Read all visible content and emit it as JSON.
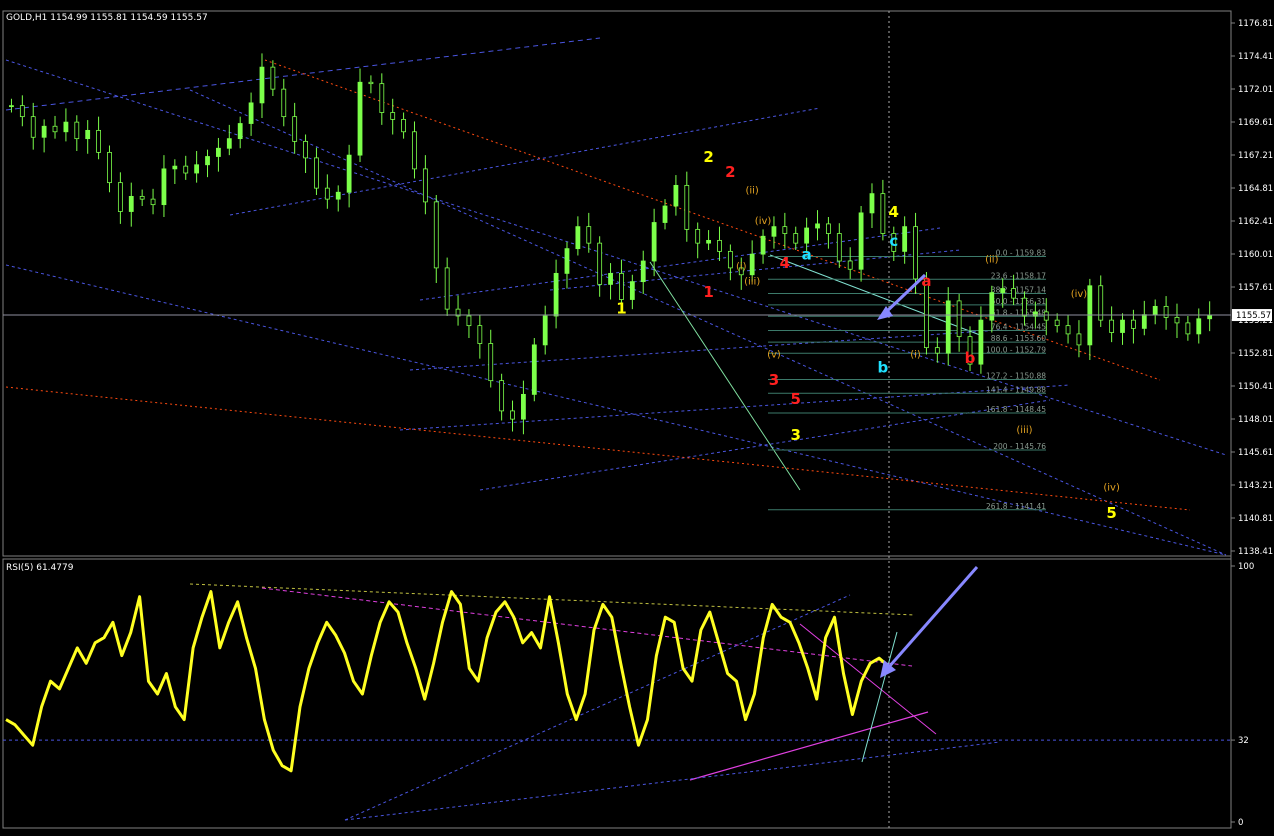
{
  "colors": {
    "background": "#000000",
    "frame": "#808080",
    "grid_blue": "#4a55e0",
    "candle_up": "#7cff4a",
    "orange_line": "#ff4a10",
    "fib": "#3c7a6a",
    "rsi_line": "#ffff22",
    "rsi_magenta": "#e040e0",
    "arrow": "#8888ff",
    "wave_yellow": "#ffff00",
    "wave_red": "#ff2020",
    "wave_cyan": "#20e0ff",
    "wave_orange": "#e0a020"
  },
  "chart_data": [
    {
      "type": "line",
      "title": "GOLD,H1  1154.99 1155.81 1154.59 1155.57",
      "symbol": "GOLD,H1",
      "ohlc": {
        "open": 1154.99,
        "high": 1155.81,
        "low": 1154.59,
        "close": 1155.57
      },
      "price_axis": {
        "min": 1138.41,
        "max": 1176.81,
        "ticks": [
          "1176.81",
          "1174.41",
          "1172.01",
          "1169.61",
          "1167.21",
          "1164.81",
          "1162.41",
          "1160.01",
          "1157.61",
          "1155.21",
          "1152.81",
          "1150.41",
          "1148.01",
          "1145.61",
          "1143.21",
          "1140.81",
          "1138.41"
        ]
      },
      "current_price": "1155.57",
      "series": [
        {
          "values": [
            1170.8,
            1170.0,
            1168.5,
            1169.3,
            1168.9,
            1169.6,
            1168.4,
            1169.0,
            1167.4,
            1165.2,
            1163.1,
            1164.2,
            1164.0,
            1163.6,
            1166.2,
            1166.4,
            1165.9,
            1166.5,
            1167.1,
            1167.7,
            1168.4,
            1169.5,
            1171.0,
            1173.6,
            1172.0,
            1170.0,
            1168.2,
            1167.0,
            1164.8,
            1164.0,
            1164.5,
            1167.2,
            1172.5,
            1172.4,
            1170.3,
            1169.8,
            1168.9,
            1166.2,
            1163.8,
            1159.0,
            1156.0,
            1155.5,
            1154.8,
            1153.5,
            1150.8,
            1148.6,
            1148.0,
            1149.8,
            1153.4,
            1155.5,
            1158.6,
            1160.4,
            1162.0,
            1160.8,
            1157.8,
            1158.6,
            1156.7,
            1158.0,
            1159.5,
            1162.3,
            1163.5,
            1165.0,
            1161.8,
            1160.8,
            1161.0,
            1160.2,
            1159.0,
            1158.5,
            1160.0,
            1161.3,
            1162.0,
            1161.5,
            1160.8,
            1161.9,
            1162.2,
            1161.5,
            1159.5,
            1158.9,
            1163.0,
            1164.4,
            1161.5,
            1160.2,
            1162.0,
            1158.2,
            1153.2,
            1152.8,
            1156.6,
            1154.0,
            1152.0,
            1155.2,
            1157.2,
            1157.5,
            1156.8,
            1155.5,
            1155.8,
            1155.2,
            1154.8,
            1154.2,
            1153.4,
            1157.7,
            1155.2,
            1154.3,
            1155.2,
            1154.6,
            1155.6,
            1156.2,
            1155.4,
            1155.0,
            1154.2,
            1155.3,
            1155.57
          ]
        }
      ],
      "fibonacci": [
        {
          "label": "0.0 - 1159.83",
          "price": 1159.83
        },
        {
          "label": "23.6 - 1158.17",
          "price": 1158.17
        },
        {
          "label": "38.2 - 1157.14",
          "price": 1157.14
        },
        {
          "label": "50.0 - 1156.31",
          "price": 1156.31
        },
        {
          "label": "61.8 - 1155.48",
          "price": 1155.48
        },
        {
          "label": "76.4 - 1154.45",
          "price": 1154.45
        },
        {
          "label": "88.6 - 1153.60",
          "price": 1153.6
        },
        {
          "label": "100.0 - 1152.79",
          "price": 1152.79
        },
        {
          "label": "127.2 - 1150.88",
          "price": 1150.88
        },
        {
          "label": "141.4 - 1149.88",
          "price": 1149.88
        },
        {
          "label": "161.8 - 1148.45",
          "price": 1148.45
        },
        {
          "label": "200 - 1145.76",
          "price": 1145.76
        },
        {
          "label": "261.8 - 1141.41",
          "price": 1141.41
        }
      ],
      "wave_labels": [
        {
          "text": "1",
          "color": "wave_yellow",
          "bar": 56,
          "price": 1155.7
        },
        {
          "text": "2",
          "color": "wave_yellow",
          "bar": 64,
          "price": 1166.7
        },
        {
          "text": "2",
          "color": "wave_red",
          "bar": 66,
          "price": 1165.6
        },
        {
          "text": "(ii)",
          "color": "wave_orange",
          "bar": 68,
          "price": 1164.4
        },
        {
          "text": "(iv)",
          "color": "wave_orange",
          "bar": 69,
          "price": 1162.2
        },
        {
          "text": "1",
          "color": "wave_red",
          "bar": 64,
          "price": 1156.9
        },
        {
          "text": "(i)",
          "color": "wave_orange",
          "bar": 67,
          "price": 1158.9
        },
        {
          "text": "(iii)",
          "color": "wave_orange",
          "bar": 68,
          "price": 1157.8
        },
        {
          "text": "4",
          "color": "wave_red",
          "bar": 71,
          "price": 1159.0
        },
        {
          "text": "a",
          "color": "wave_cyan",
          "bar": 73,
          "price": 1159.6
        },
        {
          "text": "(v)",
          "color": "wave_orange",
          "bar": 70,
          "price": 1152.5
        },
        {
          "text": "3",
          "color": "wave_red",
          "bar": 70,
          "price": 1150.5
        },
        {
          "text": "5",
          "color": "wave_red",
          "bar": 72,
          "price": 1149.1
        },
        {
          "text": "3",
          "color": "wave_yellow",
          "bar": 72,
          "price": 1146.5
        },
        {
          "text": "4",
          "color": "wave_yellow",
          "bar": 81,
          "price": 1162.7
        },
        {
          "text": "c",
          "color": "wave_cyan",
          "bar": 81,
          "price": 1160.6
        },
        {
          "text": "b",
          "color": "wave_cyan",
          "bar": 80,
          "price": 1151.4
        },
        {
          "text": "(i)",
          "color": "wave_orange",
          "bar": 83,
          "price": 1152.5
        },
        {
          "text": "a",
          "color": "wave_red",
          "bar": 84,
          "price": 1157.7
        },
        {
          "text": "b",
          "color": "wave_red",
          "bar": 88,
          "price": 1152.1
        },
        {
          "text": "(ii)",
          "color": "wave_orange",
          "bar": 90,
          "price": 1159.4
        },
        {
          "text": "(iv)",
          "color": "wave_orange",
          "bar": 98,
          "price": 1156.9
        },
        {
          "text": "(iii)",
          "color": "wave_orange",
          "bar": 93,
          "price": 1147.0
        },
        {
          "text": "(iv)",
          "color": "wave_orange",
          "bar": 101,
          "price": 1142.8
        },
        {
          "text": "5",
          "color": "wave_yellow",
          "bar": 101,
          "price": 1140.8
        }
      ]
    },
    {
      "type": "line",
      "title": "RSI(5) 61.4779",
      "ylim": [
        0,
        100
      ],
      "ticks": [
        "100",
        "32",
        "0"
      ],
      "series": [
        {
          "values": [
            40,
            38,
            34,
            30,
            45,
            55,
            52,
            60,
            68,
            62,
            70,
            72,
            78,
            65,
            74,
            88,
            55,
            50,
            58,
            45,
            40,
            68,
            80,
            90,
            68,
            78,
            86,
            72,
            60,
            40,
            28,
            22,
            20,
            45,
            60,
            70,
            78,
            73,
            66,
            55,
            50,
            65,
            78,
            86,
            82,
            70,
            60,
            48,
            62,
            78,
            90,
            85,
            60,
            55,
            72,
            82,
            86,
            80,
            70,
            74,
            68,
            88,
            70,
            50,
            40,
            50,
            75,
            85,
            80,
            62,
            45,
            30,
            40,
            65,
            80,
            78,
            60,
            55,
            75,
            82,
            70,
            58,
            55,
            40,
            50,
            72,
            85,
            80,
            78,
            70,
            60,
            48,
            72,
            80,
            58,
            42,
            55,
            62,
            64,
            61
          ]
        }
      ]
    }
  ]
}
